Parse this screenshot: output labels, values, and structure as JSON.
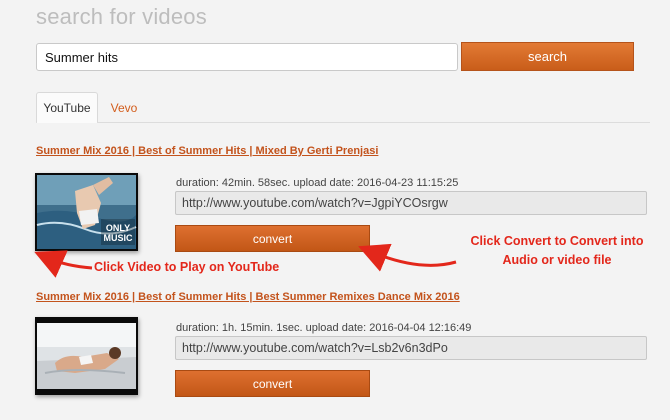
{
  "header": {
    "title": "search for videos"
  },
  "search": {
    "value": "Summer hits",
    "button_label": "search"
  },
  "tabs": [
    {
      "label": "YouTube",
      "active": true
    },
    {
      "label": "Vevo",
      "active": false
    }
  ],
  "results": [
    {
      "title": "Summer Mix 2016 | Best of Summer Hits | Mixed By Gerti Prenjasi",
      "meta": "duration: 42min. 58sec. upload date: 2016-04-23 11:15:25",
      "url": "http://www.youtube.com/watch?v=JgpiYCOsrgw",
      "convert_label": "convert",
      "thumb_text": "ONLY MUSIC"
    },
    {
      "title": "Summer Mix 2016 | Best of Summer Hits | Best Summer Remixes Dance Mix 2016",
      "meta": "duration: 1h. 15min. 1sec. upload date: 2016-04-04 12:16:49",
      "url": "http://www.youtube.com/watch?v=Lsb2v6n3dPo",
      "convert_label": "convert"
    }
  ],
  "annotations": {
    "convert_line1": "Click Convert to Convert into",
    "convert_line2": "Audio or video file",
    "video": "Click Video to Play on YouTube"
  },
  "colors": {
    "accent": "#d35d1c",
    "annotation": "#e3271b"
  }
}
